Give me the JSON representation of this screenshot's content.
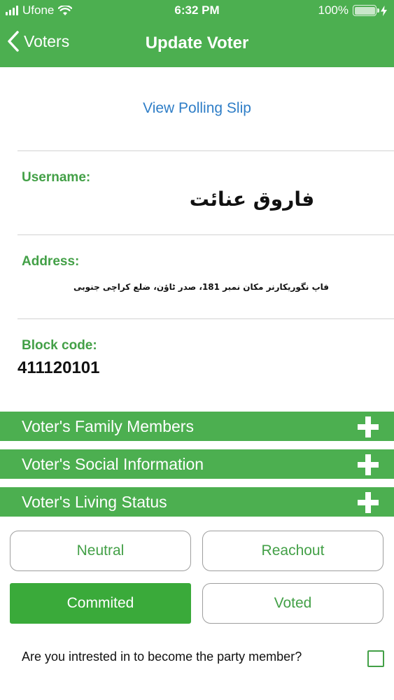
{
  "status_bar": {
    "carrier": "Ufone",
    "time": "6:32 PM",
    "battery_percent": "100%",
    "battery_level": 1.0
  },
  "nav": {
    "back_label": "Voters",
    "title": "Update Voter",
    "back_icon": "chevron-left-icon"
  },
  "polling_slip_link": "View Polling Slip",
  "fields": {
    "username_label": "Username:",
    "username_value": "فاروق عنائت",
    "address_label": "Address:",
    "address_value": "فاپ نگوریکارنر مکان نمبر 181، صدر ٹاؤن، ضلع کراچی جنوبی",
    "block_code_label": "Block code:",
    "block_code_value": "411120101"
  },
  "sections": [
    {
      "label": "Voter's Family Members",
      "icon": "plus-icon"
    },
    {
      "label": "Voter's Social Information",
      "icon": "plus-icon"
    },
    {
      "label": "Voter's Living Status",
      "icon": "plus-icon"
    }
  ],
  "status_options": [
    {
      "label": "Neutral",
      "selected": false
    },
    {
      "label": "Reachout",
      "selected": false
    },
    {
      "label": "Commited",
      "selected": true
    },
    {
      "label": "Voted",
      "selected": false
    }
  ],
  "party_member": {
    "question": "Are you intrested in to become the party member?",
    "checked": false
  },
  "colors": {
    "header_green": "#4caf50",
    "label_green": "#43a047",
    "selected_green": "#3aaa3a",
    "link_blue": "#2f7ec7"
  }
}
